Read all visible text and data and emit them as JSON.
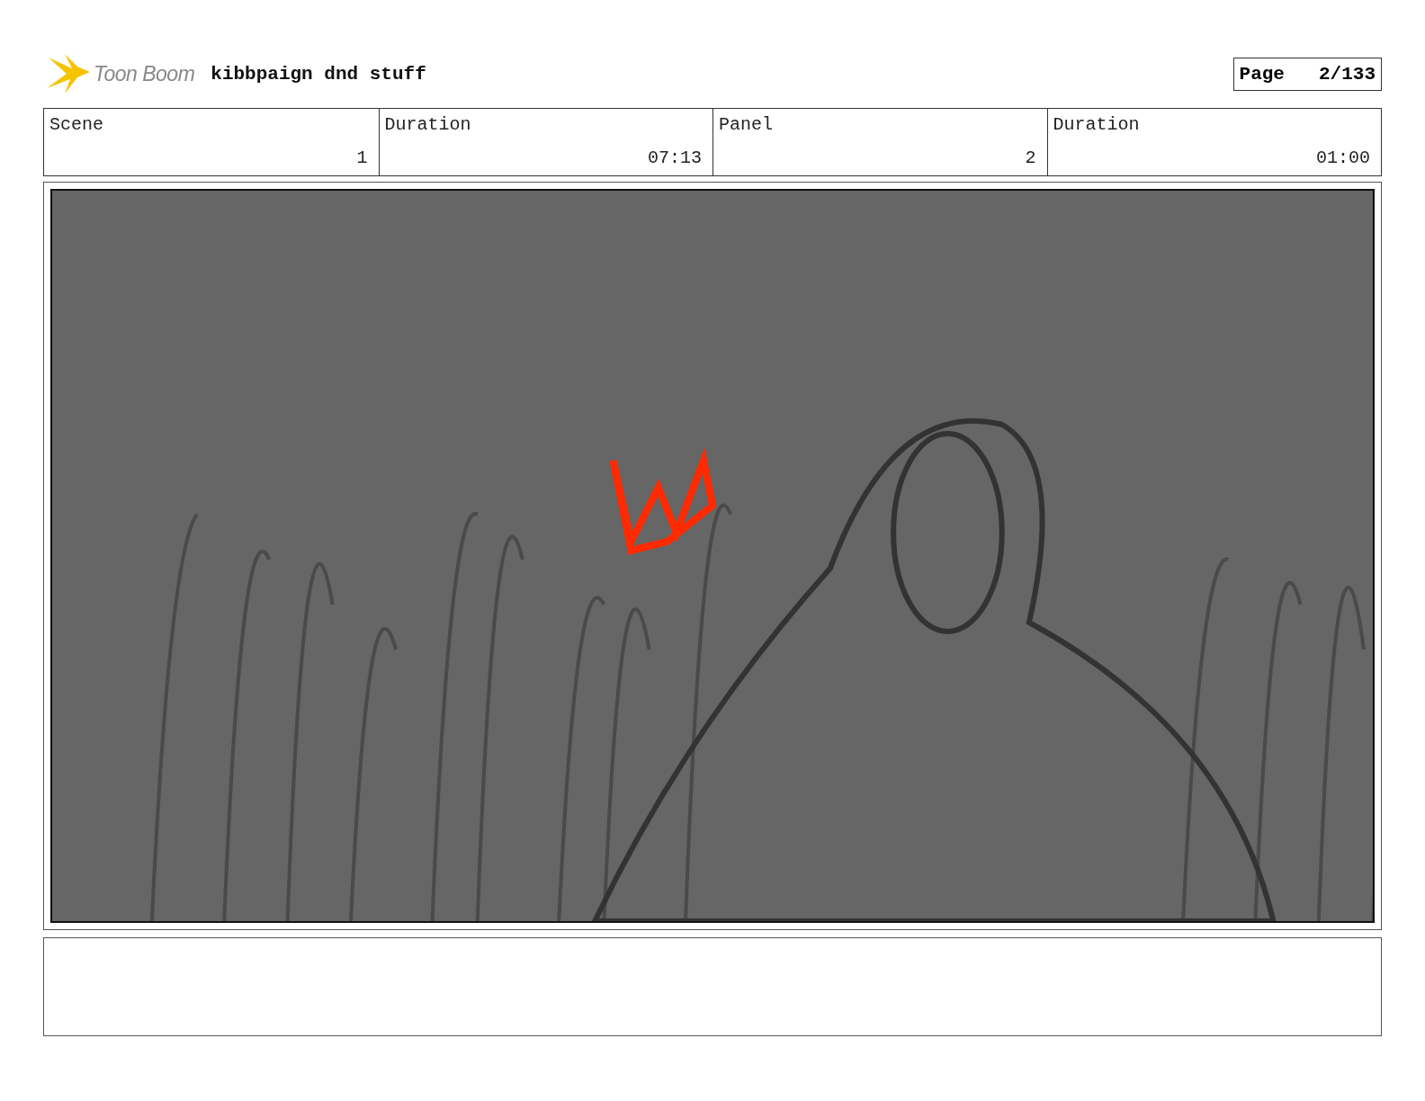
{
  "header": {
    "logo_text": "Toon Boom",
    "project_title": "kibbpaign dnd stuff",
    "page_label": "Page",
    "page_number": "2/133"
  },
  "fields": [
    {
      "label": "Scene",
      "value": "1"
    },
    {
      "label": "Duration",
      "value": "07:13"
    },
    {
      "label": "Panel",
      "value": "2"
    },
    {
      "label": "Duration",
      "value": "01:00"
    }
  ]
}
